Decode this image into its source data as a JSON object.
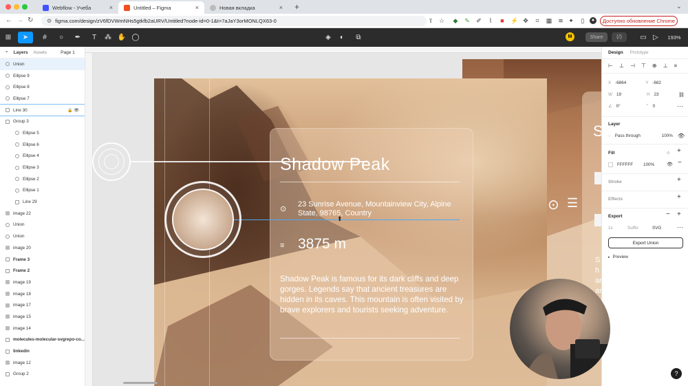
{
  "browser": {
    "tabs": [
      {
        "title": "Webflow - Учеба",
        "color": "#4353ff"
      },
      {
        "title": "Untitled – Figma",
        "color": "#f24e1e"
      },
      {
        "title": "Новая вкладка",
        "color": "#888888"
      }
    ],
    "url": "figma.com/design/zV6fDVWmNHs5gtkfb2aURV/Untitled?node-id=0-1&t=7aJaY3orMONLQX63-0",
    "update_button": "Доступно обновление Chrome",
    "new_tab": "+",
    "menu": "⌄"
  },
  "figma_toolbar": {
    "avatar": "M",
    "share": "Share",
    "zoom": "193%"
  },
  "left_panel": {
    "tabs": {
      "layers": "Layers",
      "assets": "Assets",
      "page": "Page 1"
    },
    "layers": [
      {
        "name": "Union",
        "type": "ellipse",
        "hl": true
      },
      {
        "name": "Ellipse 9",
        "type": "ellipse"
      },
      {
        "name": "Ellipse 8",
        "type": "ellipse"
      },
      {
        "name": "Ellipse 7",
        "type": "ellipse"
      },
      {
        "name": "Line 30",
        "type": "line",
        "selected": true
      },
      {
        "name": "Group 3",
        "type": "group"
      },
      {
        "name": "Ellipse 5",
        "type": "ellipse",
        "sub": true
      },
      {
        "name": "Ellipse 6",
        "type": "ellipse",
        "sub": true
      },
      {
        "name": "Ellipse 4",
        "type": "ellipse",
        "sub": true
      },
      {
        "name": "Ellipse 3",
        "type": "ellipse",
        "sub": true
      },
      {
        "name": "Ellipse 2",
        "type": "ellipse",
        "sub": true
      },
      {
        "name": "Ellipse 1",
        "type": "ellipse",
        "sub": true
      },
      {
        "name": "Line 29",
        "type": "line",
        "sub": true
      },
      {
        "name": "image 22",
        "type": "image"
      },
      {
        "name": "Union",
        "type": "ellipse"
      },
      {
        "name": "Union",
        "type": "ellipse"
      },
      {
        "name": "image 20",
        "type": "image"
      },
      {
        "name": "Frame 3",
        "type": "frame",
        "bold": true
      },
      {
        "name": "Frame 2",
        "type": "frame",
        "bold": true
      },
      {
        "name": "image 19",
        "type": "image"
      },
      {
        "name": "image 18",
        "type": "image"
      },
      {
        "name": "image 17",
        "type": "image"
      },
      {
        "name": "image 15",
        "type": "image"
      },
      {
        "name": "image 14",
        "type": "image"
      },
      {
        "name": "molecules-molecular-svgrepo-co...",
        "type": "frame",
        "bold": true
      },
      {
        "name": "linkedin",
        "type": "frame",
        "bold": true
      },
      {
        "name": "image 12",
        "type": "image"
      },
      {
        "name": "Group 2",
        "type": "group"
      }
    ]
  },
  "canvas": {
    "card": {
      "title": "Shadow Peak",
      "address": "23 Sunrise Avenue, Mountainview City, Alpine State, 98765, Country",
      "height": "3875 m",
      "description": "Shadow Peak is famous for its dark cliffs and deep gorges. Legends say that ancient treasures are hidden in its caves. This mountain is often visited by brave explorers and tourists seeking adventure."
    },
    "right_card_text": "Sh ar ar Th"
  },
  "right_panel": {
    "tabs": {
      "design": "Design",
      "prototype": "Prototype"
    },
    "x_label": "X",
    "x_value": "-6864",
    "y_label": "Y",
    "y_value": "-682",
    "w_label": "W",
    "w_value": "19",
    "h_label": "H",
    "h_value": "23",
    "rotation": "0°",
    "radius": "0",
    "layer_title": "Layer",
    "blend_mode": "Pass through",
    "layer_opacity": "100%",
    "fill_title": "Fill",
    "fill_hex": "FFFFFF",
    "fill_opacity": "100%",
    "stroke_title": "Stroke",
    "effects_title": "Effects",
    "export_title": "Export",
    "export_scale": "1x",
    "export_suffix": "Suffix",
    "export_format": "SVG",
    "export_button": "Export Union",
    "preview": "Preview"
  },
  "help": "?"
}
